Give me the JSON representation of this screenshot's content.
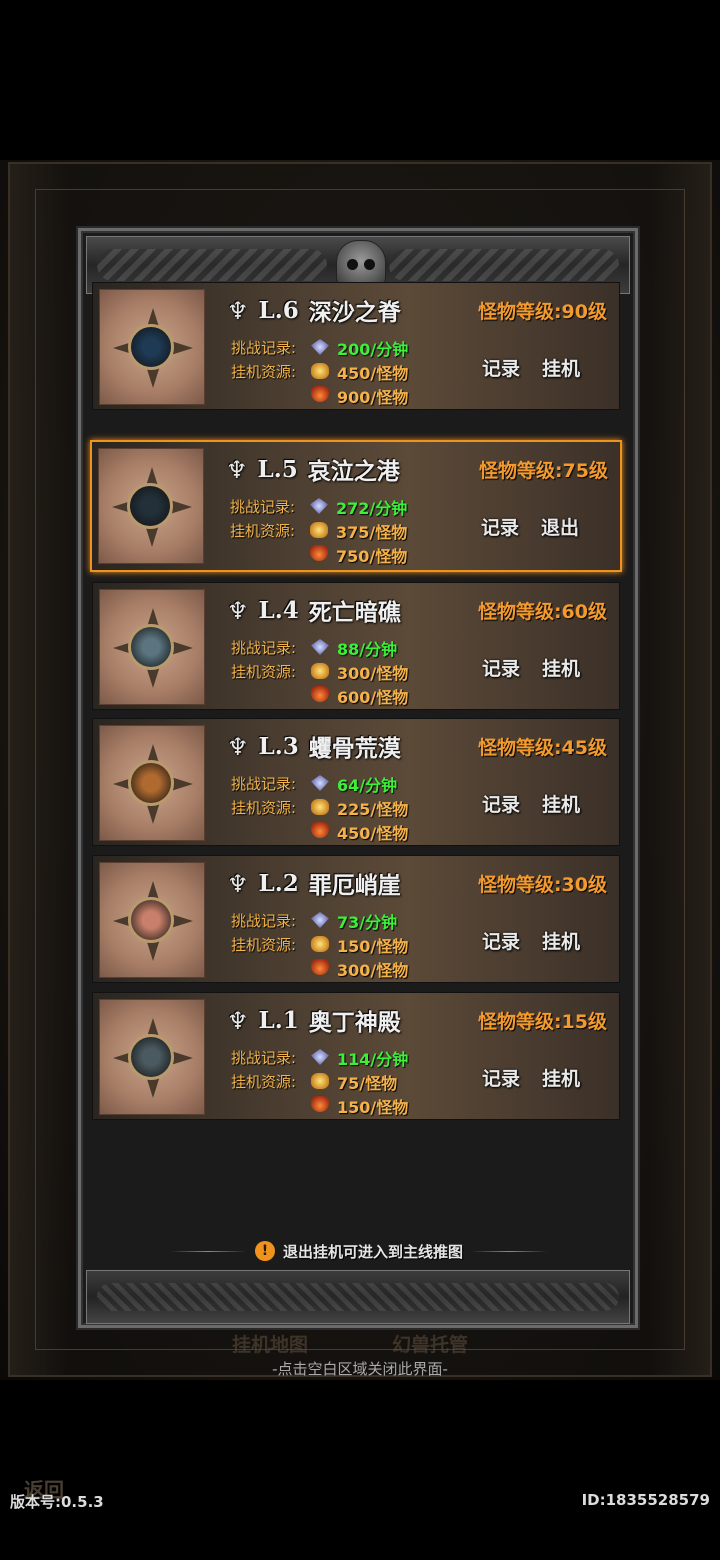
{
  "labels": {
    "challenge_record": "挑战记录:",
    "idle_resource": "挂机资源:"
  },
  "maps": [
    {
      "level": "L.6",
      "name": "深沙之脊",
      "monster_level": "怪物等级:90级",
      "challenge": "200/分钟",
      "gold": "450/怪物",
      "item": "900/怪物",
      "record_btn": "记录",
      "action_btn": "挂机",
      "active": false,
      "gem_color": "#1e3a55"
    },
    {
      "level": "L.5",
      "name": "哀泣之港",
      "monster_level": "怪物等级:75级",
      "challenge": "272/分钟",
      "gold": "375/怪物",
      "item": "750/怪物",
      "record_btn": "记录",
      "action_btn": "退出",
      "active": true,
      "gem_color": "#23303a"
    },
    {
      "level": "L.4",
      "name": "死亡暗礁",
      "monster_level": "怪物等级:60级",
      "challenge": "88/分钟",
      "gold": "300/怪物",
      "item": "600/怪物",
      "record_btn": "记录",
      "action_btn": "挂机",
      "active": false,
      "gem_color": "#5a7480"
    },
    {
      "level": "L.3",
      "name": "蠼骨荒漠",
      "monster_level": "怪物等级:45级",
      "challenge": "64/分钟",
      "gold": "225/怪物",
      "item": "450/怪物",
      "record_btn": "记录",
      "action_btn": "挂机",
      "active": false,
      "gem_color": "#b06a30"
    },
    {
      "level": "L.2",
      "name": "罪厄峭崖",
      "monster_level": "怪物等级:30级",
      "challenge": "73/分钟",
      "gold": "150/怪物",
      "item": "300/怪物",
      "record_btn": "记录",
      "action_btn": "挂机",
      "active": false,
      "gem_color": "#c8806a"
    },
    {
      "level": "L.1",
      "name": "奥丁神殿",
      "monster_level": "怪物等级:15级",
      "challenge": "114/分钟",
      "gold": "75/怪物",
      "item": "150/怪物",
      "record_btn": "记录",
      "action_btn": "挂机",
      "active": false,
      "gem_color": "#4a5a60"
    }
  ],
  "hint": {
    "icon": "exclamation-icon",
    "text": "退出挂机可进入到主线推图"
  },
  "bottom_tabs": {
    "left": "挂机地图",
    "right": "幻兽托管"
  },
  "close_hint": "-点击空白区域关闭此界面-",
  "back_label": "返回",
  "version": "版本号:0.5.3",
  "uid": "ID:1835528579",
  "colors": {
    "accent": "#f0931e",
    "green": "#3cf03a",
    "orange": "#f29a2e"
  }
}
